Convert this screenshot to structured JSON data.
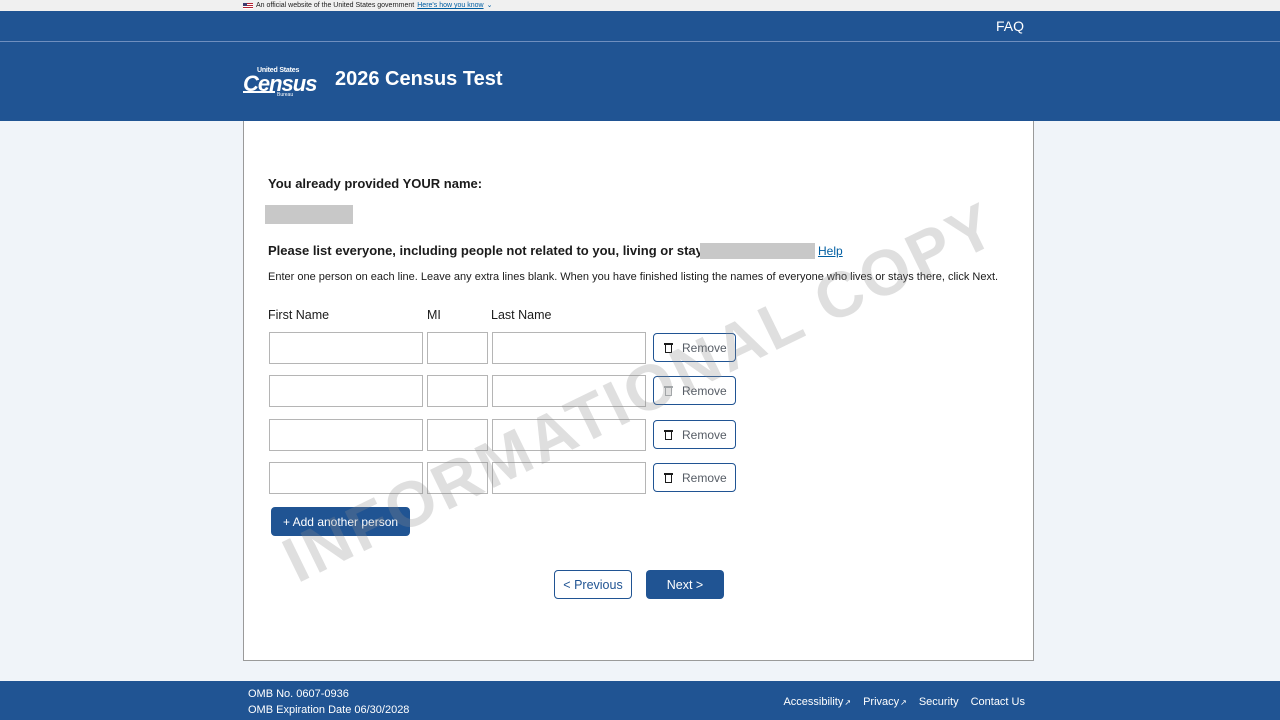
{
  "gov_banner": {
    "text": "An official website of the United States government",
    "link": "Here's how you know"
  },
  "header": {
    "faq": "FAQ",
    "logo": {
      "top": "United States",
      "main": "Census",
      "bottom": "Bureau"
    },
    "title": "2026 Census Test"
  },
  "form": {
    "already_provided_label": "You already provided YOUR name:",
    "question": "Please list everyone, including people not related to you, living or staying at",
    "help_link": "Help",
    "instructions": "Enter one person on each line. Leave any extra lines blank. When you have finished listing the names of everyone who lives or stays there, click Next.",
    "columns": {
      "first": "First Name",
      "mi": "MI",
      "last": "Last Name"
    },
    "rows": [
      {
        "first": "",
        "mi": "",
        "last": "",
        "remove_label": "Remove"
      },
      {
        "first": "",
        "mi": "",
        "last": "",
        "remove_label": "Remove"
      },
      {
        "first": "",
        "mi": "",
        "last": "",
        "remove_label": "Remove"
      },
      {
        "first": "",
        "mi": "",
        "last": "",
        "remove_label": "Remove"
      }
    ],
    "add_person_label": "+ Add another person",
    "previous_label": "< Previous",
    "next_label": "Next >"
  },
  "watermark": "INFORMATIONAL COPY",
  "footer": {
    "omb_number": "OMB No. 0607-0936",
    "omb_expiration": "OMB Expiration Date 06/30/2028",
    "links": [
      "Accessibility",
      "Privacy",
      "Security",
      "Contact Us"
    ]
  },
  "colors": {
    "brand_blue": "#205493",
    "link_blue": "#005ea2",
    "page_bg": "#f0f4f9"
  }
}
